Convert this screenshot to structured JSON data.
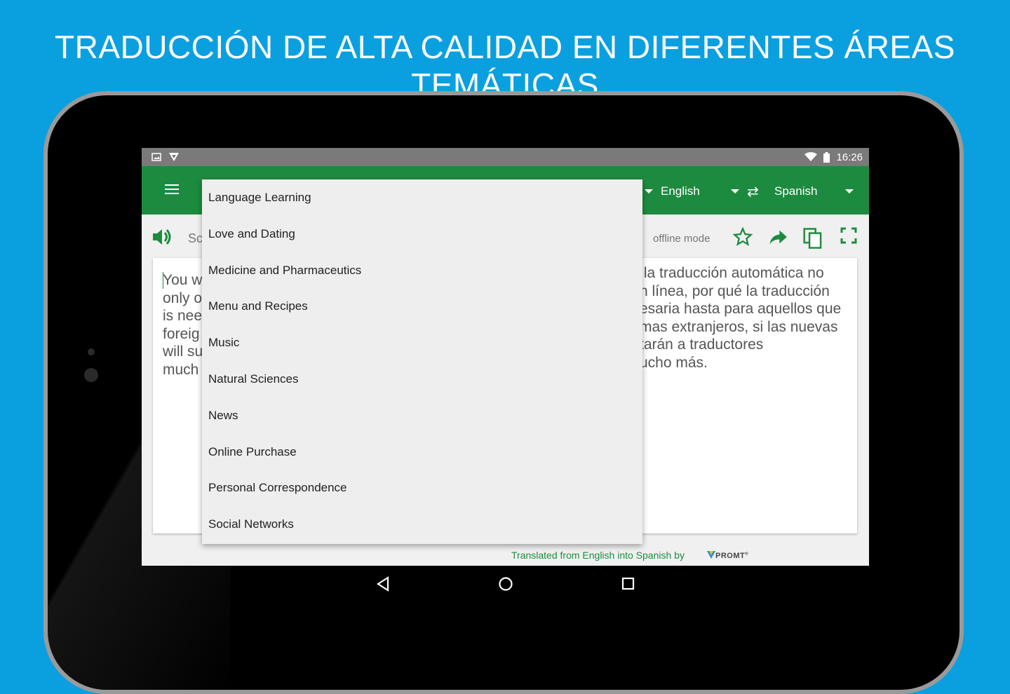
{
  "banner": {
    "title": "TRADUCCIÓN DE ALTA CALIDAD  EN DIFERENTES ÁREAS TEMÁTICAS"
  },
  "status_bar": {
    "time": "16:26",
    "icons": [
      "image-icon",
      "promt-icon",
      "wifi-icon",
      "battery-icon"
    ]
  },
  "app_bar": {
    "menu_icon": "hamburger-icon",
    "source_language": "English",
    "target_language": "Spanish",
    "swap_icon": "swap-icon"
  },
  "toolbar": {
    "source_label_partial": "Sc",
    "offline_label": "offline mode",
    "icons": [
      "speaker-icon",
      "star-icon",
      "share-icon",
      "copy-icon",
      "fullscreen-icon"
    ]
  },
  "source_text": "You w\nonly o\nis nee\nforeig\nwill su\nmuch",
  "target_text": " la traducción automática no\nn línea, por qué la traducción\nesaria hasta para aquellos que\nmas extranjeros, si las nuevas\ntarán a traductores\nucho más.",
  "topics": [
    "Language Learning",
    "Love and Dating",
    "Medicine and Pharmaceutics",
    "Menu and Recipes",
    "Music",
    "Natural Sciences",
    "News",
    "Online Purchase",
    "Personal Correspondence",
    "Social Networks"
  ],
  "footer": {
    "credit": "Translated from English into Spanish by",
    "brand": "PROMT"
  },
  "colors": {
    "background": "#0aa0e0",
    "app_green": "#1d8b3f",
    "status_bar": "#7a7a7a"
  }
}
